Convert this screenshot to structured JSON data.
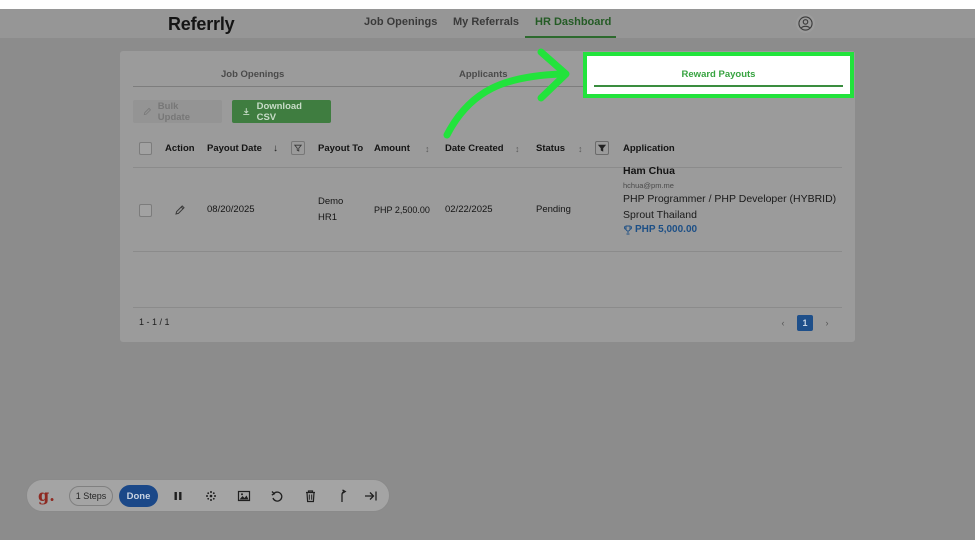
{
  "nav": {
    "logo": "Referrly",
    "links": [
      "Job Openings",
      "My Referrals",
      "HR Dashboard"
    ],
    "active_link": "HR Dashboard",
    "avatar_icon": "user-circle-icon"
  },
  "tabs": {
    "job_openings": "Job Openings",
    "applicants": "Applicants",
    "reward_payouts": "Reward Payouts"
  },
  "actions": {
    "bulk_update": "Bulk Update",
    "download_csv": "Download CSV"
  },
  "table": {
    "headers": {
      "action": "Action",
      "payout_date": "Payout Date",
      "payout_to": "Payout To",
      "amount": "Amount",
      "date_created": "Date Created",
      "status": "Status",
      "application": "Application"
    },
    "rows": [
      {
        "payout_date": "08/20/2025",
        "payout_to_line1": "Demo",
        "payout_to_line2": "HR1",
        "amount": "PHP 2,500.00",
        "date_created": "02/22/2025",
        "status": "Pending",
        "applicant_name": "Ham Chua",
        "applicant_email": "hchua@pm.me",
        "job_title": "PHP Programmer / PHP Developer (HYBRID)",
        "company": "Sprout Thailand",
        "reward": "PHP 5,000.00"
      }
    ]
  },
  "pagination": {
    "summary": "1 - 1 / 1",
    "current_page": "1",
    "prev": "‹",
    "next": "›"
  },
  "recorder": {
    "steps": "1 Steps",
    "done": "Done",
    "logo": "g."
  },
  "colors": {
    "highlight": "#22e33c",
    "arrow": "#22e33c",
    "brand_green": "#37a340",
    "done_blue": "#1b4888"
  }
}
